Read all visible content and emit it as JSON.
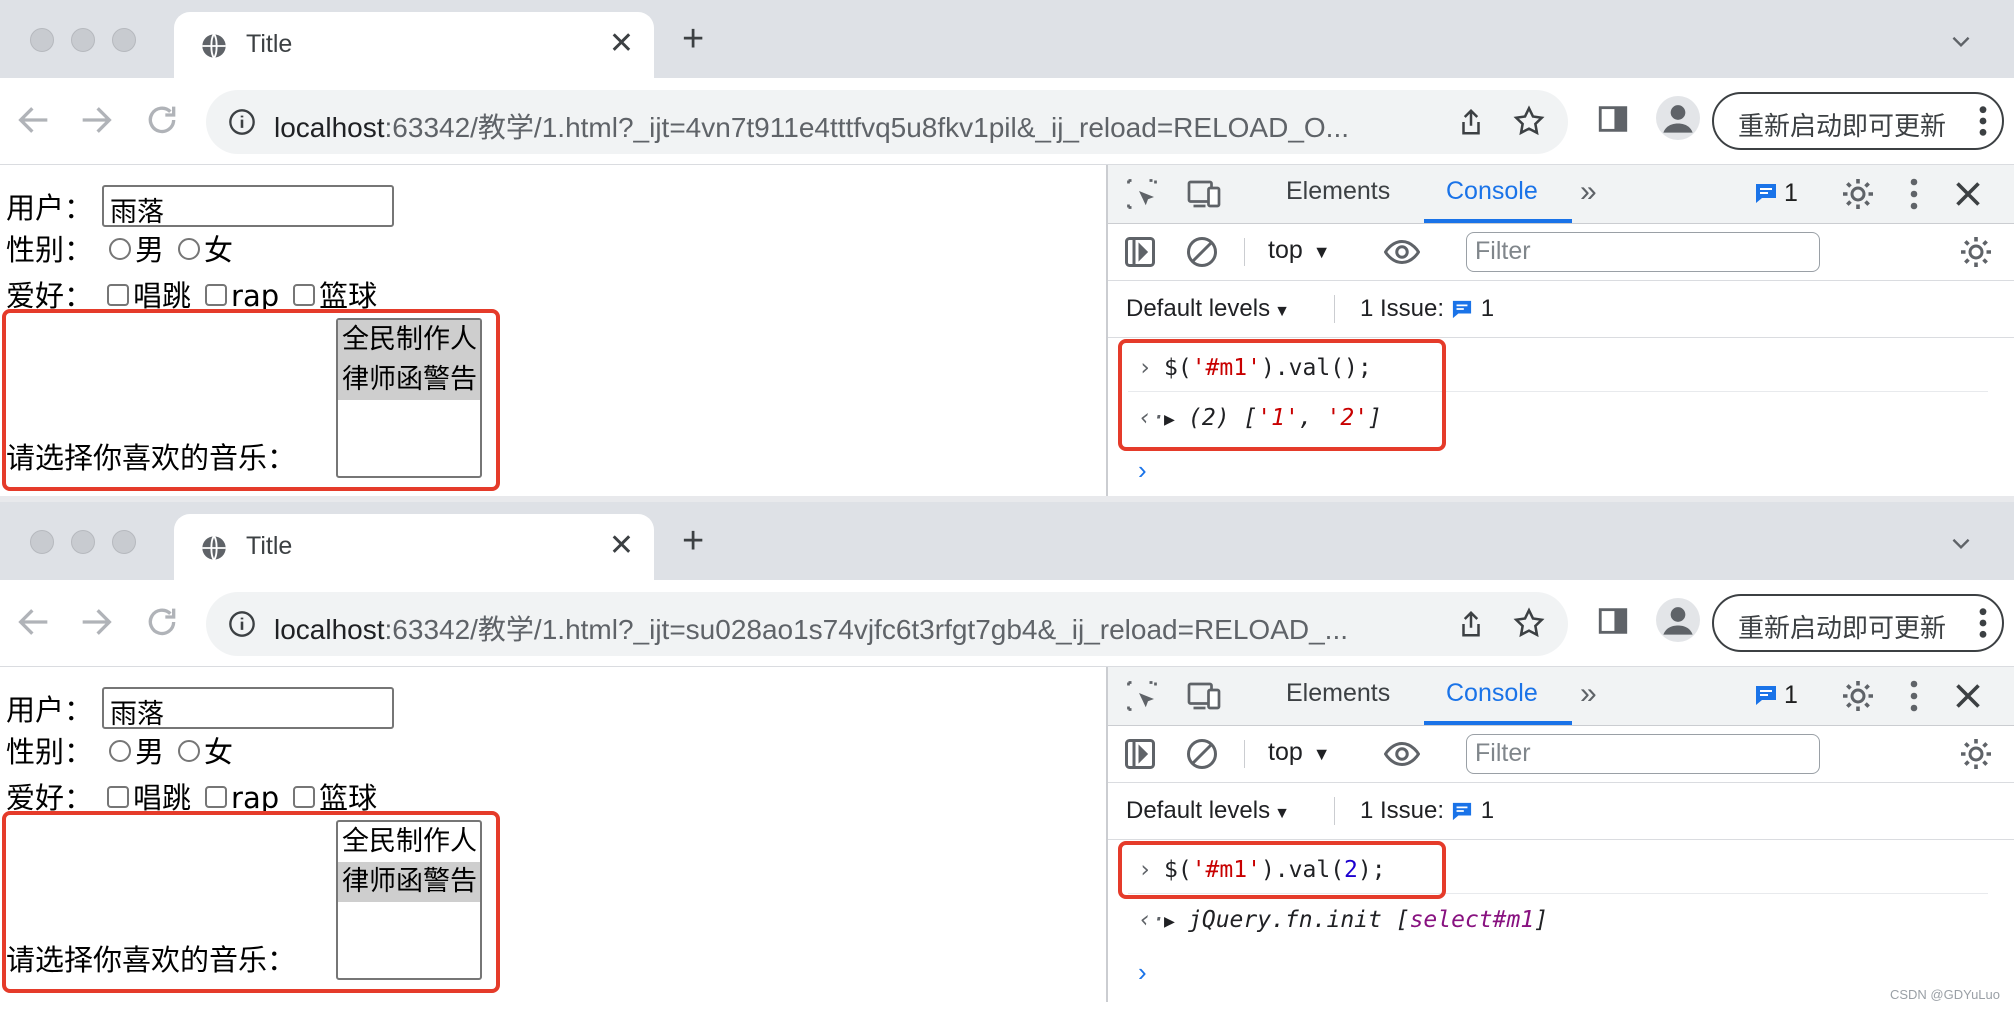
{
  "windows": [
    {
      "tab": {
        "title": "Title"
      },
      "url": {
        "host": "localhost",
        "rest": ":63342/教学/1.html?_ijt=4vn7t911e4tttfvq5u8fkv1pil&_ij_reload=RELOAD_O..."
      },
      "update_button": "重新启动即可更新",
      "form": {
        "user_label": "用户：",
        "user_value": "雨落",
        "gender_label": "性别：",
        "gender_options": [
          "男",
          "女"
        ],
        "hobby_label": "爱好：",
        "hobby_options": [
          "唱跳",
          "rap",
          "篮球"
        ],
        "music_label": "请选择你喜欢的音乐：",
        "music_options": [
          "全民制作人",
          "律师函警告"
        ],
        "music_selected": [
          true,
          true
        ]
      },
      "devtools": {
        "tabs": [
          "Elements",
          "Console"
        ],
        "active_tab": "Console",
        "message_count": "1",
        "context": "top",
        "filter_placeholder": "Filter",
        "levels": "Default levels",
        "issues_label": "1 Issue:",
        "issues_count": "1",
        "input": {
          "prefix": "$(",
          "string": "'#m1'",
          "suffix": ").val();"
        },
        "output": {
          "prefix": "(2) [",
          "items": [
            "'1'",
            "'2'"
          ],
          "sep": ", ",
          "suffix": "]"
        }
      }
    },
    {
      "tab": {
        "title": "Title"
      },
      "url": {
        "host": "localhost",
        "rest": ":63342/教学/1.html?_ijt=su028ao1s74vjfc6t3rfgt7gb4&_ij_reload=RELOAD_..."
      },
      "update_button": "重新启动即可更新",
      "form": {
        "user_label": "用户：",
        "user_value": "雨落",
        "gender_label": "性别：",
        "gender_options": [
          "男",
          "女"
        ],
        "hobby_label": "爱好：",
        "hobby_options": [
          "唱跳",
          "rap",
          "篮球"
        ],
        "music_label": "请选择你喜欢的音乐：",
        "music_options": [
          "全民制作人",
          "律师函警告"
        ],
        "music_selected": [
          false,
          true
        ]
      },
      "devtools": {
        "tabs": [
          "Elements",
          "Console"
        ],
        "active_tab": "Console",
        "message_count": "1",
        "context": "top",
        "filter_placeholder": "Filter",
        "levels": "Default levels",
        "issues_label": "1 Issue:",
        "issues_count": "1",
        "input": {
          "prefix": "$(",
          "string": "'#m1'",
          "mid": ").val(",
          "number": "2",
          "suffix": ");"
        },
        "output": {
          "prefix": "jQuery.fn.init [",
          "selector": "select#m1",
          "suffix": "]"
        }
      }
    }
  ],
  "highlight_color": "#e53b2a",
  "accent_color": "#1a73e8",
  "credit": "CSDN @GDYuLuo"
}
